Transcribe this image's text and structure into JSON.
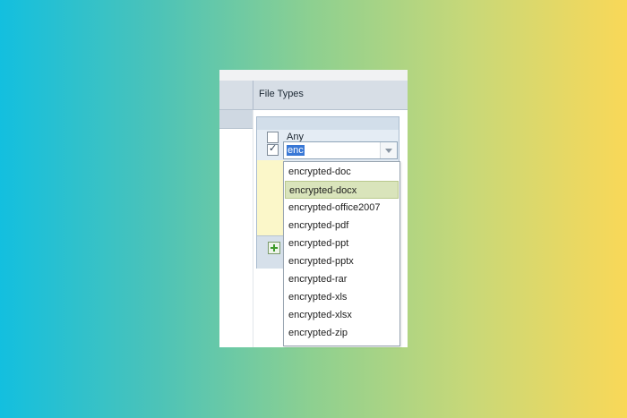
{
  "panel": {
    "header_title": "File Types",
    "any_label": "Any",
    "any_checked": false,
    "filter_checked": true,
    "combo_value": "enc"
  },
  "dropdown": {
    "selected_index": 1,
    "items": [
      "encrypted-doc",
      "encrypted-docx",
      "encrypted-office2007",
      "encrypted-pdf",
      "encrypted-ppt",
      "encrypted-pptx",
      "encrypted-rar",
      "encrypted-xls",
      "encrypted-xlsx",
      "encrypted-zip"
    ]
  },
  "icons": {
    "add": "plus-icon",
    "dropdown_arrow": "chevron-down-icon",
    "check": "checkmark-icon"
  }
}
